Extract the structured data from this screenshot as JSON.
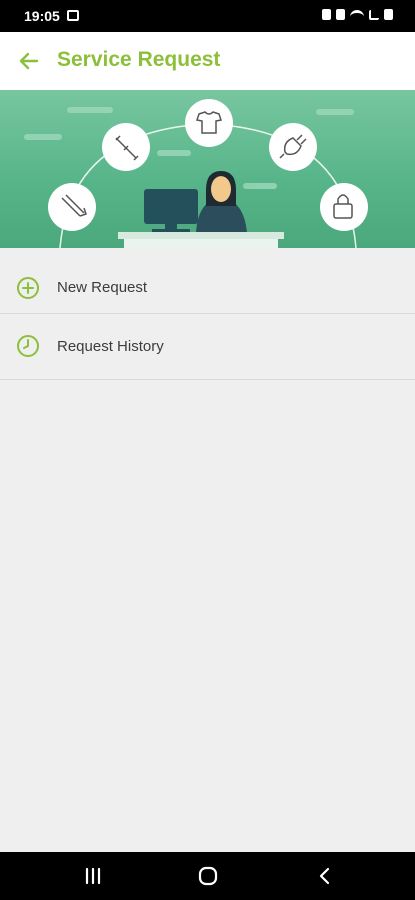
{
  "status_bar": {
    "time": "19:05",
    "icons": [
      "image-icon",
      "shield-icon",
      "alarm-icon",
      "wifi-icon",
      "signal-icon",
      "battery-icon"
    ]
  },
  "app_bar": {
    "title": "Service Request",
    "back_icon": "arrow-left-icon",
    "accent_color": "#8cbf3a"
  },
  "banner": {
    "illustration": "customer-service-desk",
    "service_icons": [
      "paint-brush-icon",
      "plumbing-icon",
      "laundry-icon",
      "plug-icon",
      "lock-icon"
    ]
  },
  "menu": {
    "items": [
      {
        "label": "New Request",
        "icon": "plus-circle-icon"
      },
      {
        "label": "Request History",
        "icon": "clock-icon"
      }
    ]
  },
  "nav_bar": {
    "buttons": [
      "recent-apps-icon",
      "home-icon",
      "back-icon"
    ]
  }
}
